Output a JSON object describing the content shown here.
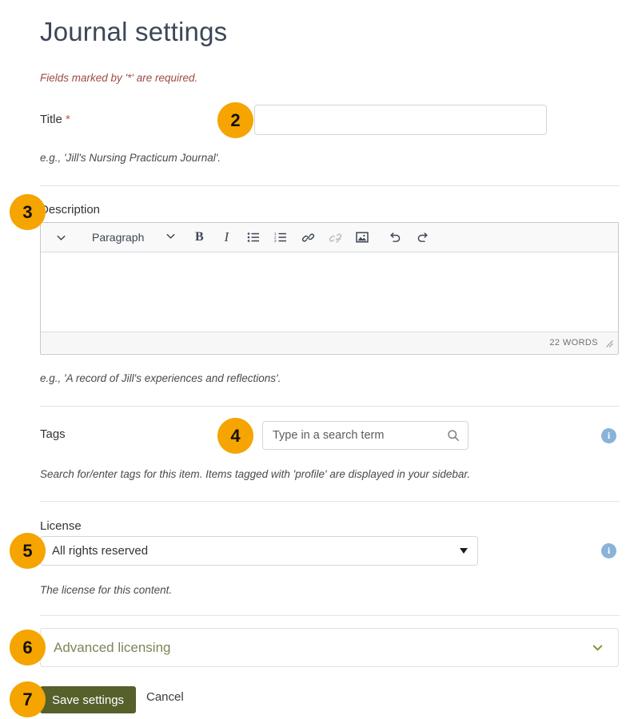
{
  "page": {
    "title": "Journal settings",
    "required_note": "Fields marked by '*' are required."
  },
  "form": {
    "title_field": {
      "label": "Title",
      "required_marker": "*",
      "value": "",
      "placeholder": "",
      "help": "e.g., 'Jill's Nursing Practicum Journal'."
    },
    "description_field": {
      "label": "Description",
      "help": "e.g., 'A record of Jill's experiences and reflections'.",
      "editor": {
        "block_format": "Paragraph",
        "word_count": "22 WORDS",
        "body_html": "",
        "toolbar": [
          {
            "name": "block-format-expand-icon",
            "icon": "chevron-down",
            "label": ""
          },
          {
            "name": "block-format-select",
            "icon": "text",
            "label": "Paragraph"
          },
          {
            "name": "block-format-caret-icon",
            "icon": "chevron-down",
            "label": ""
          },
          {
            "name": "bold-button",
            "icon": "bold",
            "label": "B"
          },
          {
            "name": "italic-button",
            "icon": "italic",
            "label": "I"
          },
          {
            "name": "bullet-list-button",
            "icon": "bullet-list",
            "label": ""
          },
          {
            "name": "numbered-list-button",
            "icon": "numbered-list",
            "label": ""
          },
          {
            "name": "link-button",
            "icon": "link",
            "label": ""
          },
          {
            "name": "unlink-button",
            "icon": "unlink",
            "label": "",
            "disabled": true
          },
          {
            "name": "image-button",
            "icon": "image",
            "label": ""
          },
          {
            "name": "undo-button",
            "icon": "undo",
            "label": ""
          },
          {
            "name": "redo-button",
            "icon": "redo",
            "label": ""
          }
        ]
      }
    },
    "tags_field": {
      "label": "Tags",
      "placeholder": "Type in a search term",
      "value": "",
      "help": "Search for/enter tags for this item. Items tagged with 'profile' are displayed in your sidebar.",
      "info_tooltip": "i"
    },
    "license_field": {
      "label": "License",
      "selected": "All rights reserved",
      "help": "The license for this content.",
      "info_tooltip": "i"
    },
    "advanced_licensing": {
      "label": "Advanced licensing",
      "expanded": false
    },
    "actions": {
      "save_label": "Save settings",
      "cancel_label": "Cancel"
    }
  },
  "steps": [
    {
      "number": "2",
      "target": "title-input"
    },
    {
      "number": "3",
      "target": "description-label"
    },
    {
      "number": "4",
      "target": "tags-input"
    },
    {
      "number": "5",
      "target": "license-select"
    },
    {
      "number": "6",
      "target": "advanced-licensing"
    },
    {
      "number": "7",
      "target": "save-button"
    }
  ],
  "colors": {
    "badge": "#f5a400",
    "save_button": "#55602b",
    "required_note": "#9e4b43",
    "info_icon": "#8ab3d8",
    "collapsible_text": "#7d8556"
  }
}
